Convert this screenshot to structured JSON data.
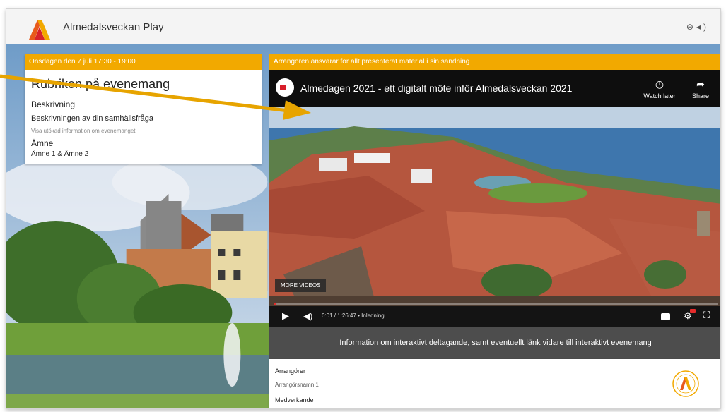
{
  "header": {
    "app_title": "Almedalsveckan Play",
    "icons": [
      "globe-icon",
      "volume-icon"
    ]
  },
  "event": {
    "date": "Onsdagen den 7 juli 17:30 - 19:00",
    "title": "Rubriken på evenemang",
    "beskrivning_label": "Beskrivning",
    "beskrivning_sub": "Beskrivningen av din samhällsfråga",
    "visa_info": "Visa utökad information om evenemanget",
    "amne_label": "Ämne",
    "amne_value": "Ämne 1 & Ämne 2"
  },
  "player": {
    "disclaimer": "Arrangören ansvarar för allt presenterat material i sin sändning",
    "video_title": "Almedagen 2021 - ett digitalt möte inför Almedalsveckan 2021",
    "watch_later": "Watch later",
    "share": "Share",
    "more_videos": "MORE VIDEOS",
    "time": "0:01 / 1:26:47 • Inledning",
    "progress": 0.001,
    "info_text": "Information om interaktivt deltagande, samt eventuellt länk vidare till interaktivt evenemang"
  },
  "details": {
    "arrangorer_label": "Arrangörer",
    "arrangorer_name": "Arrangörsnamn 1",
    "medverkande_label": "Medverkande"
  },
  "colors": {
    "accent": "#f2a900",
    "player_bar": "#0e0e0e",
    "progress": "#e52b2b",
    "info_bar": "#4d4d4d"
  }
}
